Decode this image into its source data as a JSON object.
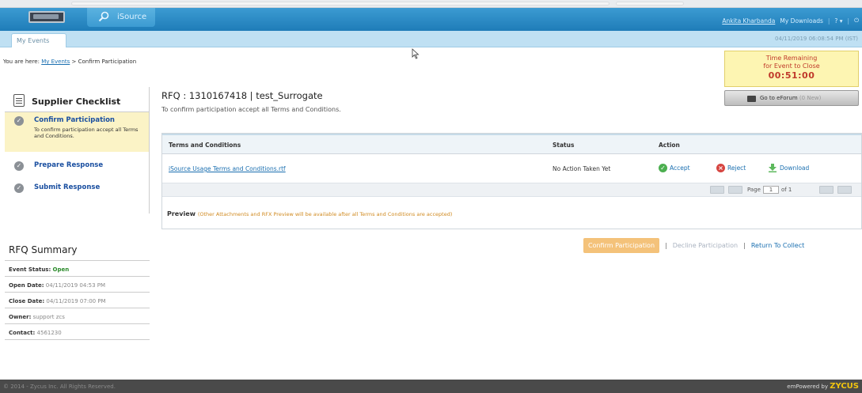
{
  "header": {
    "app_name": "iSource",
    "user": "Ankita Kharbanda",
    "downloads": "My Downloads",
    "help": "? ▾",
    "power": "⏻"
  },
  "subnav": {
    "tab": "My Events",
    "datetime": "04/11/2019 06:08:54 PM (IST)"
  },
  "breadcrumb": {
    "prefix": "You are here:",
    "link": "My Events",
    "current": "> Confirm Participation"
  },
  "timer": {
    "line1": "Time Remaining",
    "line2": "for Event to Close",
    "time": "00:51:00"
  },
  "forum": {
    "label": "Go to eForum",
    "count": "(0 New)"
  },
  "checklist": {
    "title": "Supplier Checklist",
    "items": [
      {
        "label": "Confirm Participation",
        "desc": "To confirm participation accept all Terms and Conditions."
      },
      {
        "label": "Prepare Response"
      },
      {
        "label": "Submit Response"
      }
    ]
  },
  "summary": {
    "title": "RFQ Summary",
    "status_label": "Event Status:",
    "status_value": "Open",
    "open_label": "Open Date:",
    "open_value": "04/11/2019 04:53 PM",
    "close_label": "Close Date:",
    "close_value": "04/11/2019 07:00 PM",
    "owner_label": "Owner:",
    "owner_value": "support zcs",
    "contact_label": "Contact:",
    "contact_value": "4561230"
  },
  "main": {
    "title": "RFQ : 1310167418 | test_Surrogate",
    "subtitle": "To confirm participation accept all Terms and Conditions."
  },
  "table": {
    "headers": [
      "Terms and Conditions",
      "Status",
      "Action"
    ],
    "rows": [
      {
        "document": "iSource Usage Terms and Conditions.rtf",
        "status": "No Action Taken Yet",
        "accept": "Accept",
        "reject": "Reject",
        "download": "Download"
      }
    ],
    "pager": {
      "page_label": "Page",
      "page": "1",
      "of_label": "of 1"
    }
  },
  "preview": {
    "label": "Preview",
    "note": "(Other Attachments and RFX Preview will be available after all Terms and Conditions are accepted)"
  },
  "actions": {
    "confirm": "Confirm Participation",
    "sep1": "|",
    "decline": "Decline Participation",
    "sep2": "|",
    "return": "Return To Collect"
  },
  "footer": {
    "copyright": "© 2014 - Zycus Inc. All Rights Reserved.",
    "powered": "emPowered by",
    "brand": "ZYCUS"
  },
  "colors": {
    "header_blue": "#1f7cb8",
    "timer_red": "#c0392b",
    "open_green": "#2a8a2a",
    "confirm_orange": "#f4c27a",
    "zycus_yellow": "#f1c40f"
  }
}
